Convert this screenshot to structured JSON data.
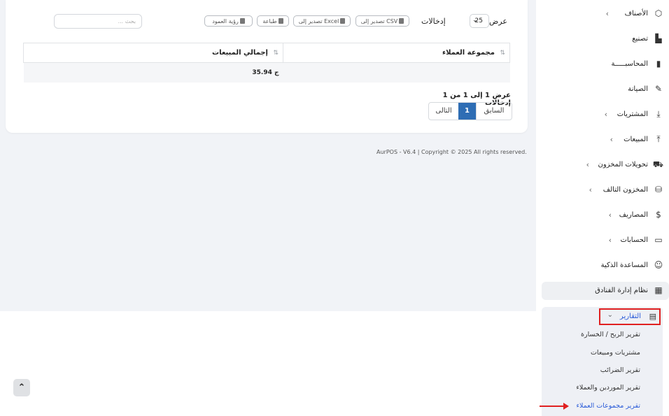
{
  "toolbar": {
    "show_label": "عرض",
    "entries_label": "إدخالات",
    "page_size": "25",
    "buttons": {
      "csv": "تصدير إلى CSV",
      "excel": "تصدير إلى Excel",
      "print": "طباعة",
      "columns": "رؤية العمود"
    },
    "search_placeholder": "بحث ..."
  },
  "table": {
    "headers": [
      "مجموعة العملاء",
      "إجمالي المبيعات"
    ],
    "rows": [
      {
        "group": "",
        "total": "35.94 ج"
      }
    ]
  },
  "pagination": {
    "info": "عرض 1 إلى 1 من 1 إدخالات",
    "prev": "السابق",
    "current": "1",
    "next": "التالى"
  },
  "footer": {
    "text": "AurPOS - V6.4 | Copyright © 2025 All rights reserved."
  },
  "sidebar": {
    "items": [
      {
        "label": "الأصناف",
        "icon": "box-icon",
        "glyph": "⬡"
      },
      {
        "label": "تصنيع",
        "icon": "factory-icon",
        "glyph": "▙"
      },
      {
        "label": "المحاسبـــــة",
        "icon": "book-icon",
        "glyph": "▮"
      },
      {
        "label": "الصيانة",
        "icon": "wrench-icon",
        "glyph": "🔧"
      },
      {
        "label": "المشتريات",
        "icon": "download-icon",
        "glyph": "⤓"
      },
      {
        "label": "المبيعات",
        "icon": "upload-icon",
        "glyph": "⤒"
      },
      {
        "label": "تحويلات المخزون",
        "icon": "truck-icon",
        "glyph": "⛟"
      },
      {
        "label": "المخزون التالف",
        "icon": "database-icon",
        "glyph": "⛁"
      },
      {
        "label": "المصاريف",
        "icon": "dollar-icon",
        "glyph": "$"
      },
      {
        "label": "الحسابات",
        "icon": "credit-card-icon",
        "glyph": "▭"
      },
      {
        "label": "المساعدة الذكية",
        "icon": "robot-icon",
        "glyph": "🤖"
      },
      {
        "label": "نظام إدارة الفنادق",
        "icon": "hotel-icon",
        "glyph": "▦"
      }
    ],
    "reports": {
      "label": "التقارير",
      "sub_items": [
        "تقرير الربح / الخسارة",
        "مشتريات ومبيعات",
        "تقرير الضرائب",
        "تقرير الموردين والعملاء",
        "تقرير مجموعات العملاء"
      ]
    }
  },
  "colors": {
    "primary": "#2e6db4",
    "highlight": "#e02020",
    "active_link": "#2a5bd8"
  }
}
